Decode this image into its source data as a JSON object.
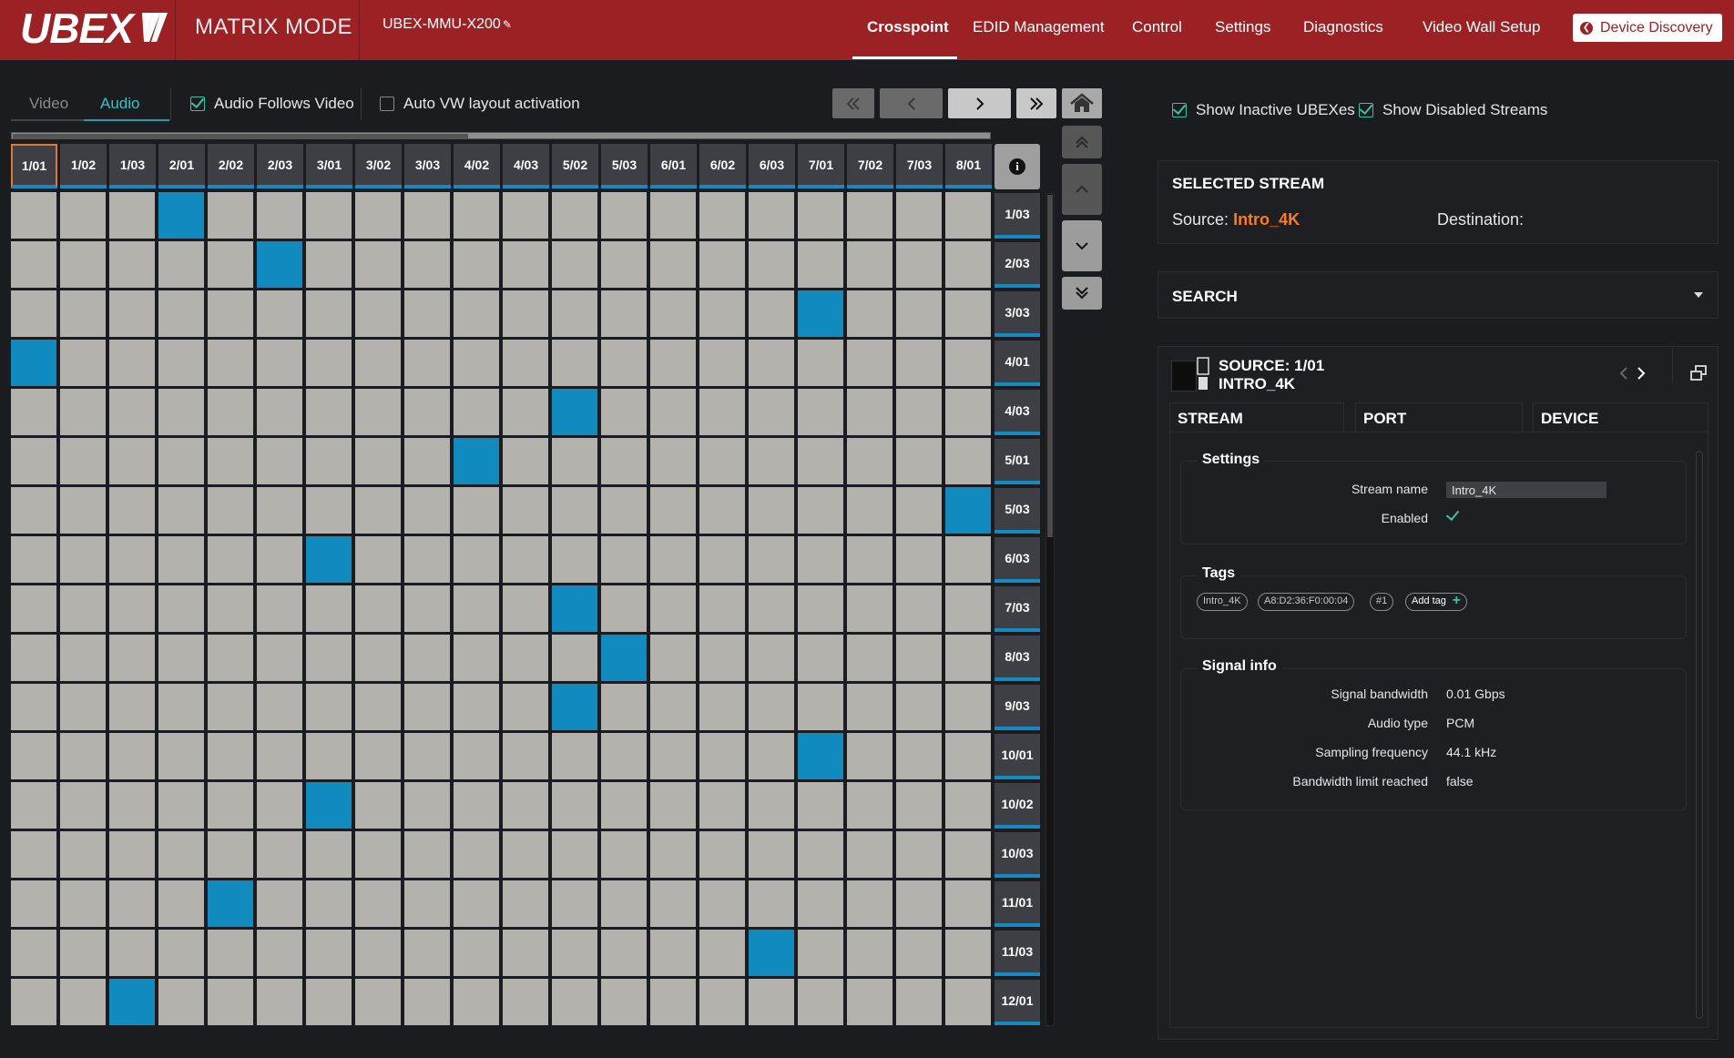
{
  "app": {
    "logo": "UBEX",
    "mode": "MATRIX MODE",
    "device_name": "UBEX-MMU-X200"
  },
  "nav": {
    "items": [
      "Crosspoint",
      "EDID Management",
      "Control",
      "Settings",
      "Diagnostics",
      "Video Wall Setup"
    ],
    "active": "Crosspoint",
    "discovery_label": "Device Discovery"
  },
  "toolbar": {
    "tab_video": "Video",
    "tab_audio": "Audio",
    "active_tab": "Audio",
    "audio_follows_video": "Audio Follows Video",
    "audio_follows_video_checked": true,
    "auto_vw": "Auto VW layout activation",
    "auto_vw_checked": false
  },
  "matrix": {
    "columns": [
      "1/01",
      "1/02",
      "1/03",
      "2/01",
      "2/02",
      "2/03",
      "3/01",
      "3/02",
      "3/03",
      "4/02",
      "4/03",
      "5/02",
      "5/03",
      "6/01",
      "6/02",
      "6/03",
      "7/01",
      "7/02",
      "7/03",
      "8/01"
    ],
    "selected_column": "1/01",
    "rows": [
      "1/03",
      "2/03",
      "3/03",
      "4/01",
      "4/03",
      "5/01",
      "5/03",
      "6/03",
      "7/03",
      "8/03",
      "9/03",
      "10/01",
      "10/02",
      "10/03",
      "11/01",
      "11/03",
      "12/01"
    ],
    "active_crosspoints": [
      {
        "row": "1/03",
        "col": "2/01"
      },
      {
        "row": "2/03",
        "col": "2/03"
      },
      {
        "row": "3/03",
        "col": "7/01"
      },
      {
        "row": "4/01",
        "col": "1/01"
      },
      {
        "row": "4/03",
        "col": "5/02"
      },
      {
        "row": "5/01",
        "col": "4/02"
      },
      {
        "row": "5/03",
        "col": "8/01"
      },
      {
        "row": "6/03",
        "col": "3/01"
      },
      {
        "row": "7/03",
        "col": "5/02"
      },
      {
        "row": "8/03",
        "col": "5/03"
      },
      {
        "row": "9/03",
        "col": "5/02"
      },
      {
        "row": "10/01",
        "col": "7/01"
      },
      {
        "row": "10/02",
        "col": "3/01"
      },
      {
        "row": "11/01",
        "col": "2/02"
      },
      {
        "row": "11/03",
        "col": "6/03"
      },
      {
        "row": "12/01",
        "col": "1/03"
      }
    ]
  },
  "right_panel": {
    "show_inactive": "Show Inactive UBEXes",
    "show_inactive_checked": true,
    "show_disabled": "Show Disabled Streams",
    "show_disabled_checked": true,
    "selected_stream_title": "SELECTED STREAM",
    "source_label": "Source:",
    "source_value": "Intro_4K",
    "destination_label": "Destination:",
    "search_title": "SEARCH",
    "source_header_line1": "SOURCE: 1/01",
    "source_header_line2": "INTRO_4K",
    "tabs": [
      "STREAM",
      "PORT",
      "DEVICE"
    ],
    "settings": {
      "title": "Settings",
      "stream_name_label": "Stream name",
      "stream_name_value": "Intro_4K",
      "enabled_label": "Enabled",
      "enabled_checked": true
    },
    "tags": {
      "title": "Tags",
      "items": [
        "Intro_4K",
        "A8:D2:36:F0:00:04",
        "#1"
      ],
      "add_label": "Add tag"
    },
    "signal_info": {
      "title": "Signal info",
      "rows": [
        {
          "label": "Signal bandwidth",
          "value": "0.01 Gbps"
        },
        {
          "label": "Audio type",
          "value": "PCM"
        },
        {
          "label": "Sampling frequency",
          "value": "44.1 kHz"
        },
        {
          "label": "Bandwidth limit reached",
          "value": "false"
        }
      ]
    }
  },
  "colors": {
    "header_bg": "#9b2124",
    "active_cell": "#118ac0",
    "inactive_cell": "#b4b2ac",
    "accent_orange": "#ff7a1a",
    "accent_teal": "#3cc1a0"
  }
}
